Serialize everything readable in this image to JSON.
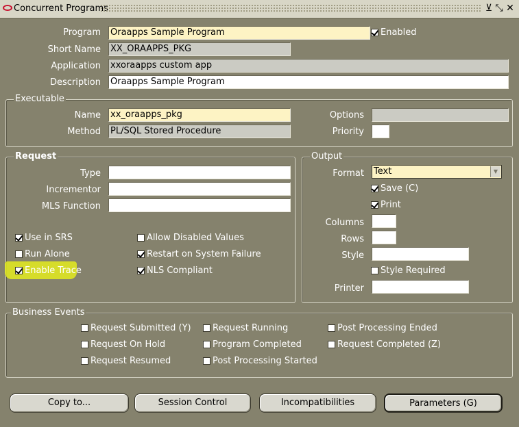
{
  "window": {
    "title": "Concurrent Programs",
    "buttons": {
      "minimize": "⊻",
      "restore": "⤡",
      "close": "✕"
    }
  },
  "program": {
    "program_label": "Program",
    "program_value": "Oraapps Sample Program",
    "enabled_label": "Enabled",
    "enabled_checked": true,
    "short_name_label": "Short Name",
    "short_name_value": "XX_ORAAPPS_PKG",
    "application_label": "Application",
    "application_value": "xxoraapps custom app",
    "description_label": "Description",
    "description_value": "Oraapps Sample Program"
  },
  "executable": {
    "title": "Executable",
    "name_label": "Name",
    "name_value": "xx_oraapps_pkg",
    "method_label": "Method",
    "method_value": "PL/SQL Stored Procedure",
    "options_label": "Options",
    "options_value": "",
    "priority_label": "Priority",
    "priority_value": ""
  },
  "request": {
    "title": "Request",
    "type_label": "Type",
    "type_value": "",
    "incrementor_label": "Incrementor",
    "incrementor_value": "",
    "mls_label": "MLS Function",
    "mls_value": "",
    "use_in_srs": "Use in SRS",
    "allow_disabled": "Allow Disabled Values",
    "run_alone": "Run Alone",
    "restart": "Restart on System Failure",
    "enable_trace": "Enable Trace",
    "nls_compliant": "NLS Compliant"
  },
  "output": {
    "title": "Output",
    "format_label": "Format",
    "format_value": "Text",
    "save_label": "Save (C)",
    "print_label": "Print",
    "columns_label": "Columns",
    "rows_label": "Rows",
    "style_label": "Style",
    "style_required": "Style Required",
    "printer_label": "Printer"
  },
  "business_events": {
    "title": "Business Events",
    "request_submitted": "Request Submitted (Y)",
    "request_on_hold": "Request On Hold",
    "request_resumed": "Request Resumed",
    "request_running": "Request Running",
    "program_completed": "Program Completed",
    "post_processing_started": "Post Processing Started",
    "post_processing_ended": "Post Processing Ended",
    "request_completed": "Request Completed (Z)"
  },
  "buttons": {
    "copy_to": "Copy to...",
    "session_control": "Session Control",
    "incompatibilities": "Incompatibilities",
    "parameters": "Parameters (G)"
  },
  "colors": {
    "background": "#85826d",
    "field_required": "#fdf3c4",
    "field_disabled": "#cbcbc3",
    "highlight": "#e4ec1e"
  }
}
